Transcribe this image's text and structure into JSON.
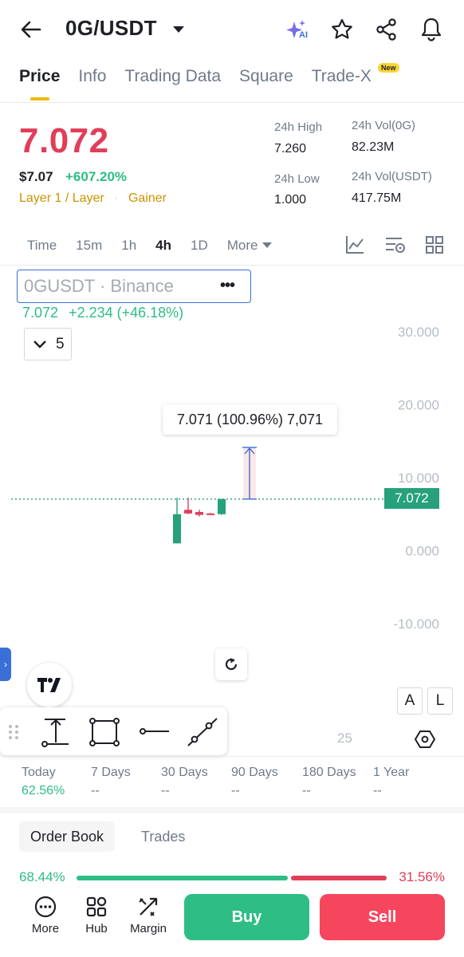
{
  "header": {
    "pair": "0G/USDT",
    "ai_label": "AI",
    "tabs": [
      "Price",
      "Info",
      "Trading Data",
      "Square",
      "Trade-X"
    ],
    "active_tab": "Price",
    "new_badge": "New"
  },
  "price": {
    "last": "7.072",
    "usd": "$7.07",
    "change_pct": "+607.20%",
    "tag_category": "Layer 1 / Layer",
    "tag_gainer": "Gainer",
    "high_label": "24h High",
    "high": "7.260",
    "low_label": "24h Low",
    "low": "1.000",
    "vol_base_label": "24h Vol(0G)",
    "vol_base": "82.23M",
    "vol_quote_label": "24h Vol(USDT)",
    "vol_quote": "417.75M"
  },
  "intervals": {
    "items": [
      "Time",
      "15m",
      "1h",
      "4h",
      "1D"
    ],
    "active": "4h",
    "more": "More"
  },
  "chart": {
    "symbol_text": "0GUSDT · Binance",
    "dots": "•••",
    "ohlc_price": "7.072",
    "ohlc_change": "+2.234 (+46.18%)",
    "collapse_count": "5",
    "tooltip": "7.071 (100.96%) 7,071",
    "current_price_tag": "7.072",
    "x_label": "25",
    "btn_a": "A",
    "btn_l": "L",
    "colors": {
      "up": "#26a17b",
      "down": "#e03e5a",
      "accent": "#3a6fd8"
    }
  },
  "chart_data": {
    "type": "candlestick",
    "y_ticks": [
      "30.000",
      "20.000",
      "10.000",
      "0.000",
      "-10.000"
    ],
    "ylim": [
      -10,
      30
    ],
    "x_ticks": [
      "25"
    ],
    "last_price": 7.072,
    "candles": [
      {
        "o": 1.0,
        "h": 7.26,
        "l": 1.0,
        "c": 5.0,
        "dir": "up"
      },
      {
        "o": 5.6,
        "h": 7.26,
        "l": 5.0,
        "c": 5.1,
        "dir": "down"
      },
      {
        "o": 5.3,
        "h": 5.6,
        "l": 4.7,
        "c": 4.9,
        "dir": "down"
      },
      {
        "o": 5.1,
        "h": 5.2,
        "l": 4.9,
        "c": 5.0,
        "dir": "down"
      },
      {
        "o": 5.0,
        "h": 7.1,
        "l": 4.9,
        "c": 7.072,
        "dir": "up"
      }
    ],
    "measure": {
      "from": 7.071,
      "to": 14.142,
      "label": "7.071 (100.96%) 7,071"
    }
  },
  "performance": [
    {
      "label": "Today",
      "value": "62.56%"
    },
    {
      "label": "7 Days",
      "value": "--"
    },
    {
      "label": "30 Days",
      "value": "--"
    },
    {
      "label": "90 Days",
      "value": "--"
    },
    {
      "label": "180 Days",
      "value": "--"
    },
    {
      "label": "1 Year",
      "value": "--"
    }
  ],
  "orderbook": {
    "tab_orderbook": "Order Book",
    "tab_trades": "Trades",
    "bid_pct": "68.44%",
    "ask_pct": "31.56%",
    "bid_ratio": 0.6844
  },
  "bottom": {
    "more": "More",
    "hub": "Hub",
    "margin": "Margin",
    "buy": "Buy",
    "sell": "Sell"
  }
}
